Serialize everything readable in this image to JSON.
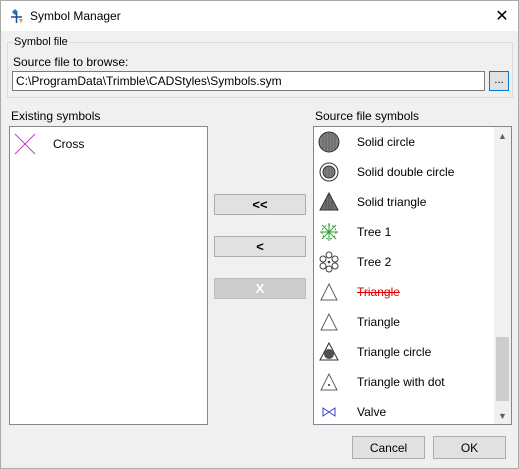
{
  "window": {
    "title": "Symbol Manager",
    "close_glyph": "✕"
  },
  "symbol_file": {
    "group_label": "Symbol file",
    "source_label": "Source file to browse:",
    "path_value": "C:\\ProgramData\\Trimble\\CADStyles\\Symbols.sym",
    "browse_label": "..."
  },
  "existing": {
    "label": "Existing symbols",
    "items": [
      {
        "name": "Cross",
        "icon": "cross-icon"
      }
    ]
  },
  "buttons": {
    "add_all": "<<",
    "add": "<",
    "remove": "X",
    "cancel": "Cancel",
    "ok": "OK"
  },
  "source": {
    "label": "Source file symbols",
    "items": [
      {
        "name": "Solid circle",
        "icon": "solid-circle-icon"
      },
      {
        "name": "Solid double circle",
        "icon": "solid-double-circle-icon"
      },
      {
        "name": "Solid triangle",
        "icon": "solid-triangle-icon"
      },
      {
        "name": "Tree 1",
        "icon": "tree-1-icon"
      },
      {
        "name": "Tree 2",
        "icon": "tree-2-icon"
      },
      {
        "name": "Triangle",
        "icon": "triangle-icon",
        "struck": true
      },
      {
        "name": "Triangle",
        "icon": "triangle-icon"
      },
      {
        "name": "Triangle circle",
        "icon": "triangle-circle-icon"
      },
      {
        "name": "Triangle with dot",
        "icon": "triangle-with-dot-icon"
      },
      {
        "name": "Valve",
        "icon": "valve-icon"
      }
    ]
  },
  "colors": {
    "accent": "#0078d7",
    "struck_text": "#e00000",
    "cross": "#c040c0",
    "tree": "#2ca02c",
    "valve": "#4040d0"
  }
}
